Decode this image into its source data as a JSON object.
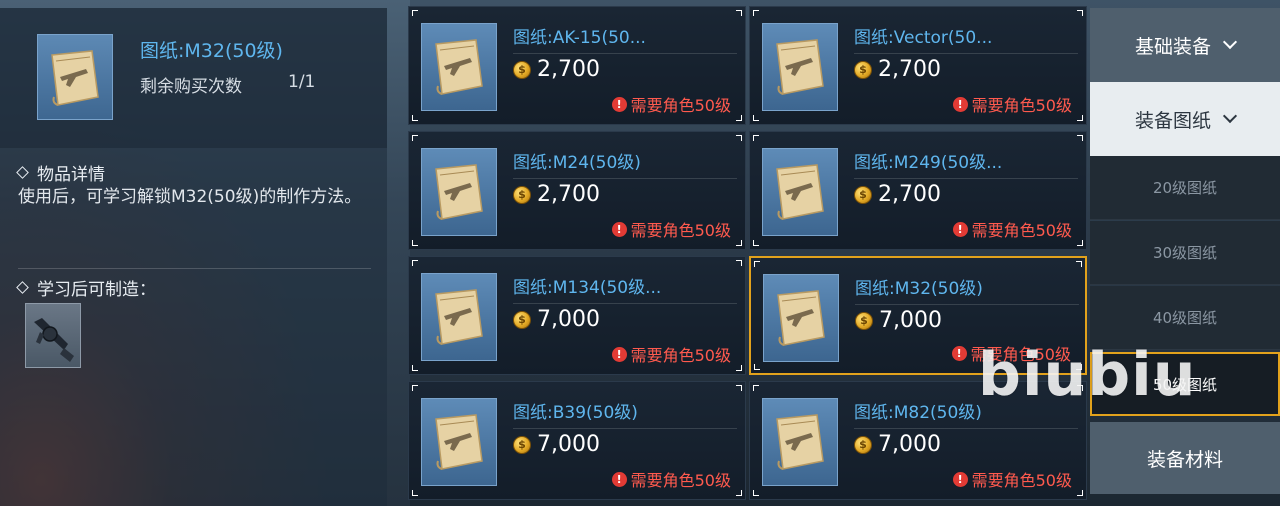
{
  "detail": {
    "title": "图纸:M32(50级)",
    "remain_label": "剩余购买次数",
    "remain_value": "1/1",
    "info_title": "物品详情",
    "info_desc": "使用后，可学习解锁M32(50级)的制作方法。",
    "craft_title": "学习后可制造："
  },
  "items": [
    {
      "name": "图纸:AK-15(50...",
      "price": "2,700",
      "requirement": "需要角色50级",
      "selected": false
    },
    {
      "name": "图纸:Vector(50...",
      "price": "2,700",
      "requirement": "需要角色50级",
      "selected": false
    },
    {
      "name": "图纸:M24(50级)",
      "price": "2,700",
      "requirement": "需要角色50级",
      "selected": false
    },
    {
      "name": "图纸:M249(50级...",
      "price": "2,700",
      "requirement": "需要角色50级",
      "selected": false
    },
    {
      "name": "图纸:M134(50级...",
      "price": "7,000",
      "requirement": "需要角色50级",
      "selected": false
    },
    {
      "name": "图纸:M32(50级)",
      "price": "7,000",
      "requirement": "需要角色50级",
      "selected": true
    },
    {
      "name": "图纸:B39(50级)",
      "price": "7,000",
      "requirement": "需要角色50级",
      "selected": false
    },
    {
      "name": "图纸:M82(50级)",
      "price": "7,000",
      "requirement": "需要角色50级",
      "selected": false
    }
  ],
  "menu": {
    "basic_equipment": "基础装备",
    "equipment_blueprints": "装备图纸",
    "sub": [
      "20级图纸",
      "30级图纸",
      "40级图纸",
      "50级图纸"
    ],
    "active_sub": "50级图纸",
    "equipment_materials": "装备材料"
  },
  "watermark": "biubiu",
  "colors": {
    "accent_selected": "#e2a21c",
    "item_name": "#5fb6ee",
    "requirement": "#ff5a4e",
    "coin": "#e3a925"
  }
}
